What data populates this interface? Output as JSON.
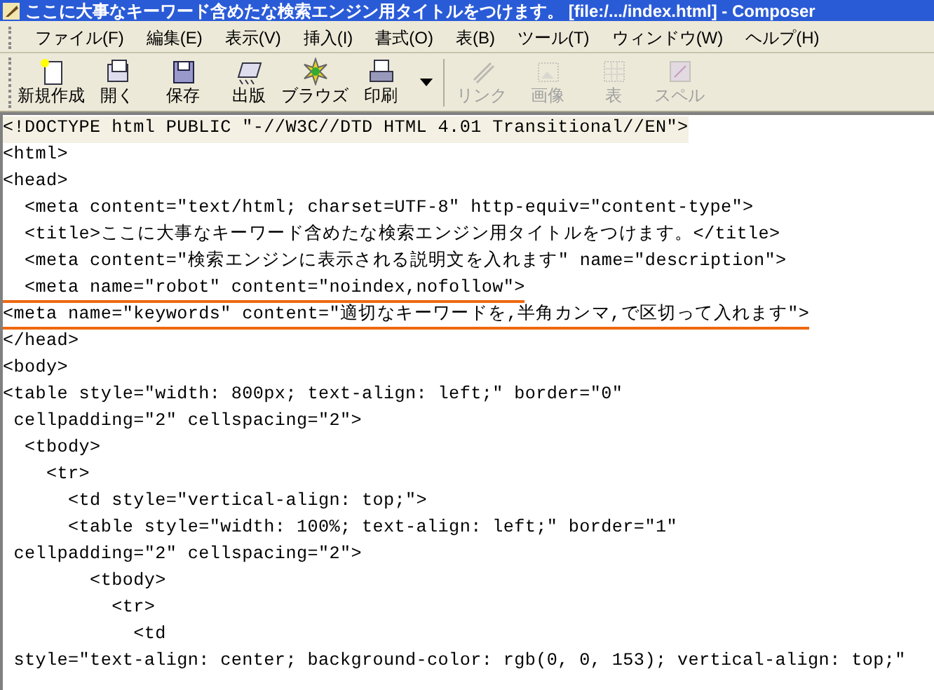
{
  "window": {
    "title": "ここに大事なキーワード含めたな検索エンジン用タイトルをつけます。 [file:/.../index.html] - Composer"
  },
  "menu": [
    "ファイル(F)",
    "編集(E)",
    "表示(V)",
    "挿入(I)",
    "書式(O)",
    "表(B)",
    "ツール(T)",
    "ウィンドウ(W)",
    "ヘルプ(H)"
  ],
  "toolbar": [
    {
      "label": "新規作成",
      "kind": "new",
      "disabled": false
    },
    {
      "label": "開く",
      "kind": "open",
      "disabled": false
    },
    {
      "label": "保存",
      "kind": "save",
      "disabled": false
    },
    {
      "label": "出版",
      "kind": "publish",
      "disabled": false
    },
    {
      "label": "ブラウズ",
      "kind": "browse",
      "disabled": false
    },
    {
      "label": "印刷",
      "kind": "print",
      "disabled": false
    },
    {
      "label": "リンク",
      "kind": "link",
      "disabled": true
    },
    {
      "label": "画像",
      "kind": "image",
      "disabled": true
    },
    {
      "label": "表",
      "kind": "table",
      "disabled": true
    },
    {
      "label": "スペル",
      "kind": "spell",
      "disabled": true
    }
  ],
  "editor": {
    "lines": [
      {
        "text": "<!DOCTYPE html PUBLIC \"-//W3C//DTD HTML 4.01 Transitional//EN\">",
        "highlighted": true,
        "underlined": false
      },
      {
        "text": "<html>",
        "highlighted": false,
        "underlined": false
      },
      {
        "text": "<head>",
        "highlighted": false,
        "underlined": false
      },
      {
        "text": "  <meta content=\"text/html; charset=UTF-8\" http-equiv=\"content-type\">",
        "highlighted": false,
        "underlined": false
      },
      {
        "text": "  <title>ここに大事なキーワード含めたな検索エンジン用タイトルをつけます。</title>",
        "highlighted": false,
        "underlined": false
      },
      {
        "text": "  <meta content=\"検索エンジンに表示される説明文を入れます\" name=\"description\">",
        "highlighted": false,
        "underlined": false
      },
      {
        "text": "  <meta name=\"robot\" content=\"noindex,nofollow\">",
        "highlighted": false,
        "underlined": true
      },
      {
        "text": "<meta name=\"keywords\" content=\"適切なキーワードを,半角カンマ,で区切って入れます\">",
        "highlighted": false,
        "underlined": true
      },
      {
        "text": "</head>",
        "highlighted": false,
        "underlined": false
      },
      {
        "text": "<body>",
        "highlighted": false,
        "underlined": false
      },
      {
        "text": "<table style=\"width: 800px; text-align: left;\" border=\"0\"",
        "highlighted": false,
        "underlined": false
      },
      {
        "text": " cellpadding=\"2\" cellspacing=\"2\">",
        "highlighted": false,
        "underlined": false
      },
      {
        "text": "  <tbody>",
        "highlighted": false,
        "underlined": false
      },
      {
        "text": "    <tr>",
        "highlighted": false,
        "underlined": false
      },
      {
        "text": "      <td style=\"vertical-align: top;\">",
        "highlighted": false,
        "underlined": false
      },
      {
        "text": "      <table style=\"width: 100%; text-align: left;\" border=\"1\"",
        "highlighted": false,
        "underlined": false
      },
      {
        "text": " cellpadding=\"2\" cellspacing=\"2\">",
        "highlighted": false,
        "underlined": false
      },
      {
        "text": "        <tbody>",
        "highlighted": false,
        "underlined": false
      },
      {
        "text": "          <tr>",
        "highlighted": false,
        "underlined": false
      },
      {
        "text": "            <td",
        "highlighted": false,
        "underlined": false
      },
      {
        "text": " style=\"text-align: center; background-color: rgb(0, 0, 153); vertical-align: top;\"",
        "highlighted": false,
        "underlined": false
      }
    ]
  }
}
